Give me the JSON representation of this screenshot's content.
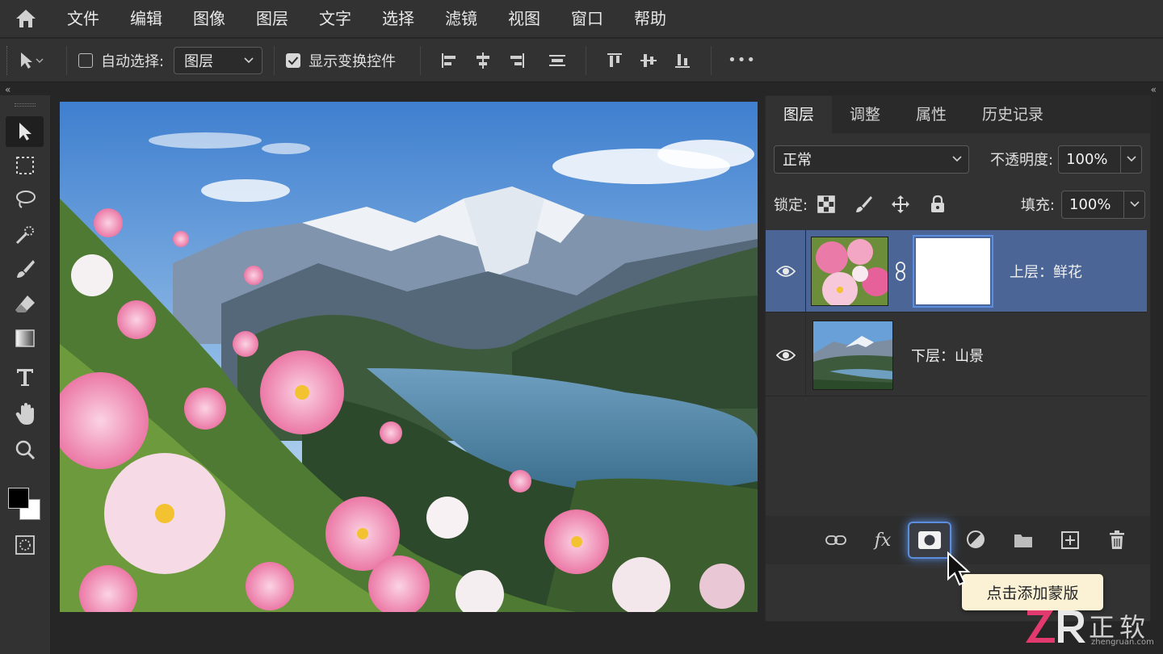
{
  "menu": {
    "items": [
      "文件",
      "编辑",
      "图像",
      "图层",
      "文字",
      "选择",
      "滤镜",
      "视图",
      "窗口",
      "帮助"
    ]
  },
  "options_bar": {
    "auto_select_label": "自动选择:",
    "auto_select_checked": false,
    "auto_select_target": "图层",
    "show_transform_label": "显示变换控件",
    "show_transform_checked": true,
    "more": "•••"
  },
  "tools": [
    "move-tool",
    "marquee-tool",
    "lasso-tool",
    "quick-select-tool",
    "brush-tool",
    "eraser-tool",
    "gradient-tool",
    "type-tool",
    "hand-tool",
    "zoom-tool"
  ],
  "colors": {
    "foreground": "#000000",
    "background": "#ffffff",
    "selected_layer": "#4a6596",
    "highlight": "#5b8de0"
  },
  "panel": {
    "tabs": [
      "图层",
      "调整",
      "属性",
      "历史记录"
    ],
    "active_tab": "图层",
    "blend_mode": "正常",
    "opacity_label": "不透明度:",
    "opacity_value": "100%",
    "lock_label": "锁定:",
    "fill_label": "填充:",
    "fill_value": "100%"
  },
  "layers": [
    {
      "name": "上层：鲜花",
      "selected": true,
      "has_mask": true
    },
    {
      "name": "下层：山景",
      "selected": false,
      "has_mask": false
    }
  ],
  "footer_buttons": [
    "link-icon",
    "fx-icon",
    "add-mask-icon",
    "adjustment-icon",
    "folder-icon",
    "new-layer-icon",
    "trash-icon"
  ],
  "tooltip": "点击添加蒙版",
  "watermark": {
    "brand": "正软",
    "url": "zhengruan.com"
  }
}
